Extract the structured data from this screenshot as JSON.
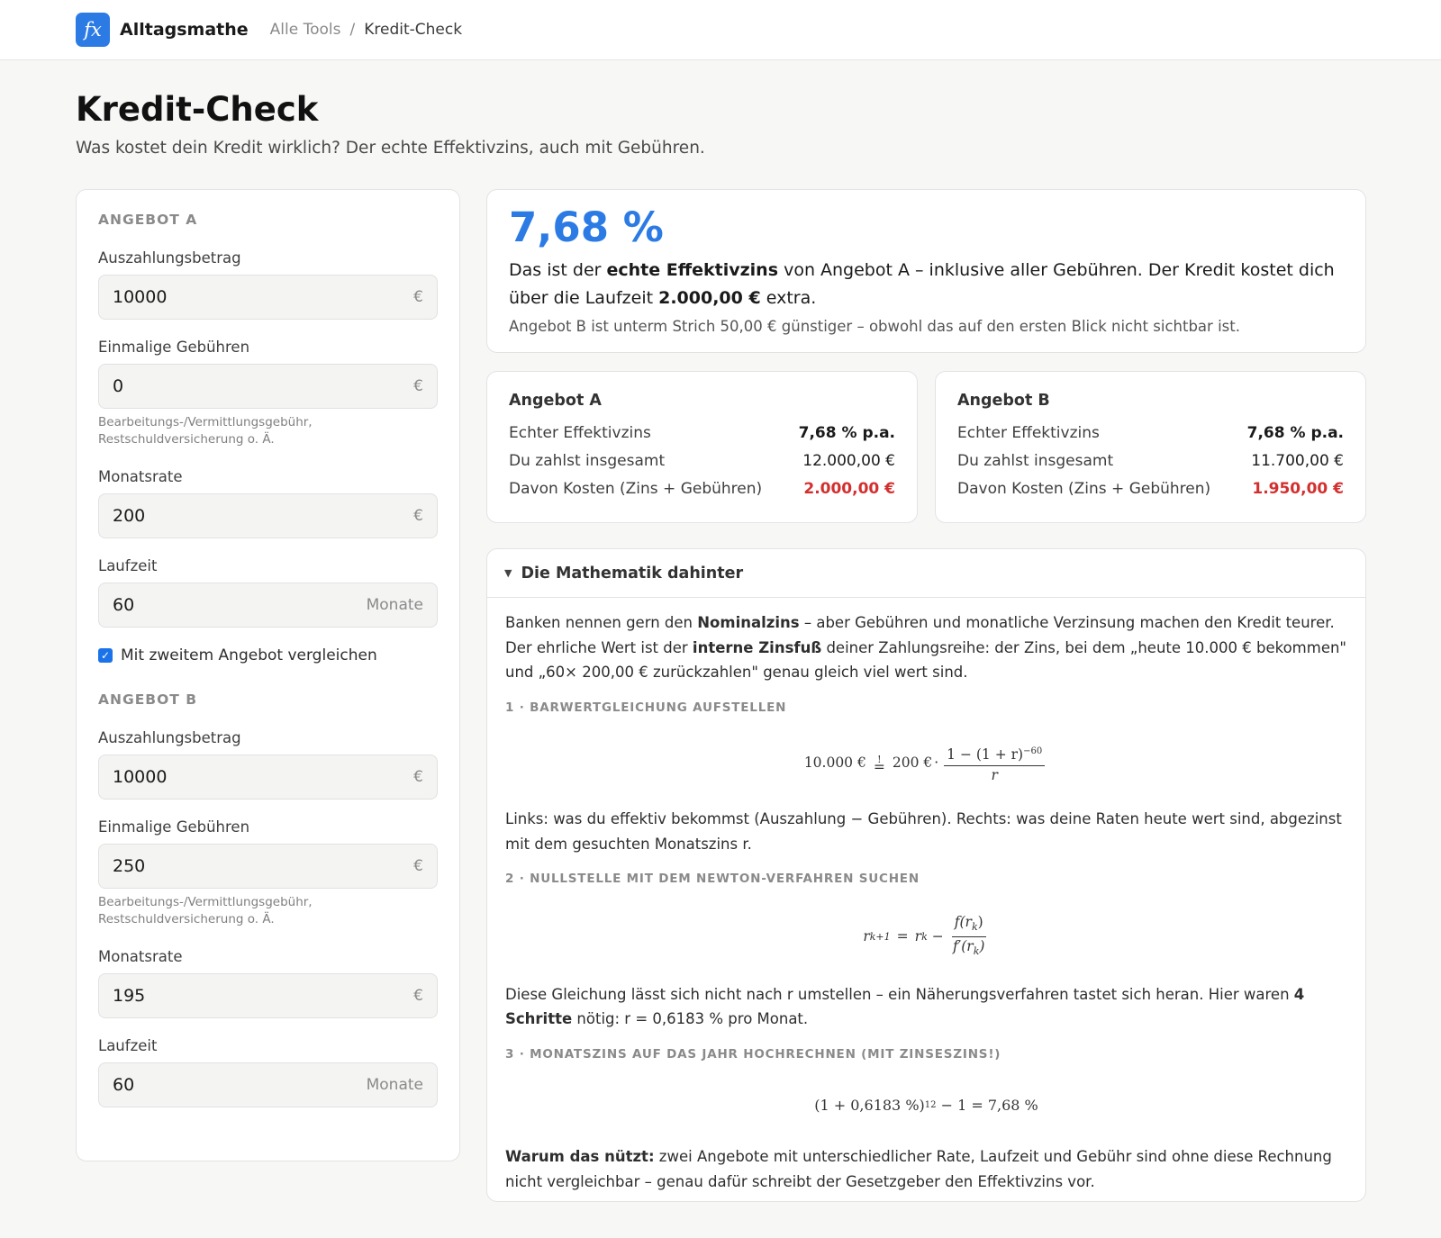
{
  "header": {
    "logo_text": "fx",
    "brand": "Alltagsmathe",
    "breadcrumb": [
      "Alle Tools",
      "/",
      "Kredit-Check"
    ]
  },
  "page": {
    "title": "Kredit-Check",
    "subtitle": "Was kostet dein Kredit wirklich? Der echte Effektivzins, auch mit Gebühren."
  },
  "offer_a": {
    "heading": "ANGEBOT A",
    "amount_label": "Auszahlungsbetrag",
    "amount": "10000",
    "amount_unit": "€",
    "fee_label": "Einmalige Gebühren",
    "fee": "0",
    "fee_unit": "€",
    "fee_hint": "Bearbeitungs-/Vermittlungsgebühr, Restschuldversicherung o. Ä.",
    "rate_label": "Monatsrate",
    "rate": "200",
    "rate_unit": "€",
    "term_label": "Laufzeit",
    "term": "60",
    "term_unit": "Monate"
  },
  "compare_checkbox": {
    "label": "Mit zweitem Angebot vergleichen",
    "checked": true
  },
  "offer_b": {
    "heading": "ANGEBOT B",
    "amount_label": "Auszahlungsbetrag",
    "amount": "10000",
    "amount_unit": "€",
    "fee_label": "Einmalige Gebühren",
    "fee": "250",
    "fee_unit": "€",
    "fee_hint": "Bearbeitungs-/Vermittlungsgebühr, Restschuldversicherung o. Ä.",
    "rate_label": "Monatsrate",
    "rate": "195",
    "rate_unit": "€",
    "term_label": "Laufzeit",
    "term": "60",
    "term_unit": "Monate"
  },
  "result": {
    "big_value": "7,68 %",
    "text_1": "Das ist der ",
    "text_bold_1": "echte Effektivzins",
    "text_2": " von Angebot A – inklusive aller Gebühren. Der Kredit kostet dich über die Laufzeit ",
    "text_bold_2": "2.000,00 €",
    "text_3": " extra.",
    "note": "Angebot B ist unterm Strich 50,00 € günstiger – obwohl das auf den ersten Blick nicht sichtbar ist."
  },
  "compare_cards": [
    {
      "title": "Angebot A",
      "rows": [
        {
          "label": "Echter Effektivzins",
          "value": "7,68 % p.a."
        },
        {
          "label": "Du zahlst insgesamt",
          "value": "12.000,00 €"
        },
        {
          "label": "Davon Kosten (Zins + Gebühren)",
          "value": "2.000,00 €"
        }
      ]
    },
    {
      "title": "Angebot B",
      "rows": [
        {
          "label": "Echter Effektivzins",
          "value": "7,68 % p.a."
        },
        {
          "label": "Du zahlst insgesamt",
          "value": "11.700,00 €"
        },
        {
          "label": "Davon Kosten (Zins + Gebühren)",
          "value": "1.950,00 €"
        }
      ]
    }
  ],
  "colors": {
    "accent": "#2c7be5",
    "cost": "#d32f2f"
  },
  "math": {
    "toggle_icon": "triangle-down-icon",
    "title": "Die Mathematik dahinter",
    "intro": {
      "t1": "Banken nennen gern den ",
      "b1": "Nominalzins",
      "t2": " – aber Gebühren und monatliche Verzinsung machen den Kredit teurer. Der ehrliche Wert ist der ",
      "b2": "interne Zinsfuß",
      "t3": " deiner Zahlungsreihe: der Zins, bei dem „heute 10.000 € bekommen\" und „60× 200,00 € zurückzahlen\" genau gleich viel wert sind."
    },
    "step1": {
      "title": "1 · BARWERTGLEICHUNG AUFSTELLEN",
      "lhs": "10.000 €",
      "rel": "=!",
      "rate": "200 €",
      "numerator": "1 − (1 + r)",
      "exponent": "−60",
      "denominator": "r",
      "text": "Links: was du effektiv bekommst (Auszahlung − Gebühren). Rechts: was deine Raten heute wert sind, abgezinst mit dem gesuchten Monatszins r."
    },
    "step2": {
      "title": "2 · NULLSTELLE MIT DEM NEWTON-VERFAHREN SUCHEN",
      "lhs": "r",
      "lhs_sub": "k+1",
      "mid": "r",
      "mid_sub": "k",
      "num": "f(r",
      "den": "f′(r",
      "sub": "k",
      "text_1": "Diese Gleichung lässt sich nicht nach r umstellen – ein Näherungsverfahren tastet sich heran. Hier waren ",
      "text_bold": "4 Schritte",
      "text_2": " nötig: r = 0,6183 % pro Monat."
    },
    "step3": {
      "title": "3 · MONATSZINS AUF DAS JAHR HOCHRECHNEN (MIT ZINSESZINS!)",
      "base": "(1 + 0,6183 %)",
      "exponent": "12",
      "rest": " − 1 = 7,68 %"
    },
    "conclusion": {
      "bold": "Warum das nützt:",
      "text": " zwei Angebote mit unterschiedlicher Rate, Laufzeit und Gebühr sind ohne diese Rechnung nicht vergleichbar – genau dafür schreibt der Gesetzgeber den Effektivzins vor."
    }
  }
}
